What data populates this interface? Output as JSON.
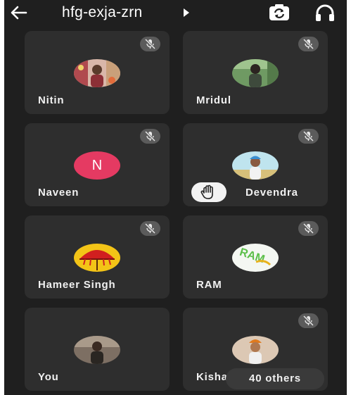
{
  "header": {
    "meeting_code": "hfg-exja-zrn"
  },
  "participants": [
    {
      "name": "Nitin",
      "muted": true,
      "avatar": "photo"
    },
    {
      "name": "Mridul",
      "muted": true,
      "avatar": "photo"
    },
    {
      "name": "Naveen",
      "muted": true,
      "avatar": "initial",
      "initial": "N",
      "color": "#e53a62"
    },
    {
      "name": "Devendra",
      "muted": true,
      "avatar": "photo",
      "hand_raised": true
    },
    {
      "name": "Hameer Singh",
      "muted": true,
      "avatar": "umbrella"
    },
    {
      "name": "RAM",
      "muted": true,
      "avatar": "text-logo",
      "logo_text": "RAM"
    },
    {
      "name": "You",
      "muted": false,
      "avatar": "photo"
    },
    {
      "name": "Kisha",
      "muted": true,
      "avatar": "photo"
    }
  ],
  "overflow": {
    "label": "40 others"
  },
  "icons": {
    "back": "arrow-left-icon",
    "switch_camera": "switch-camera-icon",
    "audio": "headphones-icon",
    "mute": "mic-off-icon",
    "hand": "raised-hand-icon"
  },
  "colors": {
    "background": "#1f1f1f",
    "tile": "#2e2e2e",
    "mute_badge": "#5b5b5b"
  }
}
